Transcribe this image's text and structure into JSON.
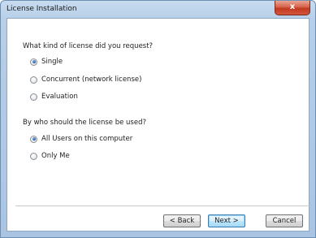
{
  "window": {
    "title": "License Installation",
    "close_label": "x"
  },
  "license_type": {
    "question": "What kind of license did you request?",
    "options": [
      {
        "label": "Single",
        "checked": true
      },
      {
        "label": "Concurrent (network license)",
        "checked": false
      },
      {
        "label": "Evaluation",
        "checked": false
      }
    ]
  },
  "license_scope": {
    "question": "By who should the license be used?",
    "options": [
      {
        "label": "All Users on this computer",
        "checked": true
      },
      {
        "label": "Only Me",
        "checked": false
      }
    ]
  },
  "buttons": {
    "back": "< Back",
    "next": "Next >",
    "cancel": "Cancel"
  }
}
